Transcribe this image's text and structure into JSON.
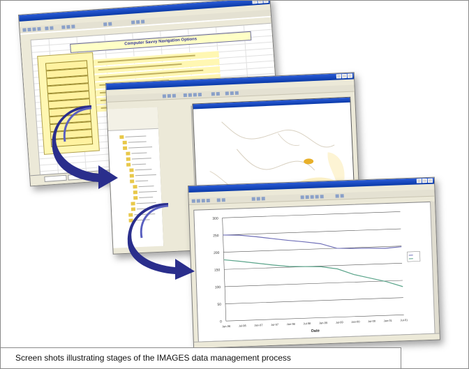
{
  "caption": "Screen shots illustrating stages of the IMAGES data management process",
  "spreadsheet": {
    "banner": "Computer Savvy Navigation Options",
    "menu_buttons": 12
  },
  "chart_data": {
    "type": "line",
    "categories": [
      "Jan-96",
      "Jul-96",
      "Jan-97",
      "Jul-97",
      "Jan-98",
      "Jul-98",
      "Jan-99",
      "Jul-99",
      "Jan-00",
      "Jul-00",
      "Jan-01",
      "Jul-01"
    ],
    "series": [
      {
        "values": [
          250,
          248,
          242,
          235,
          228,
          222,
          215,
          200,
          198,
          197,
          195,
          198
        ]
      },
      {
        "values": [
          178,
          172,
          165,
          158,
          152,
          150,
          148,
          140,
          122,
          110,
          98,
          82
        ]
      }
    ],
    "ylim": [
      0,
      300
    ],
    "yticks": [
      0,
      50,
      100,
      150,
      200,
      250,
      300
    ],
    "xlabel": "Date",
    "grid": true,
    "colors": {
      "series1": "#6f6fb8",
      "series2": "#5aa48a",
      "arrow": "#2a2e8c"
    }
  }
}
